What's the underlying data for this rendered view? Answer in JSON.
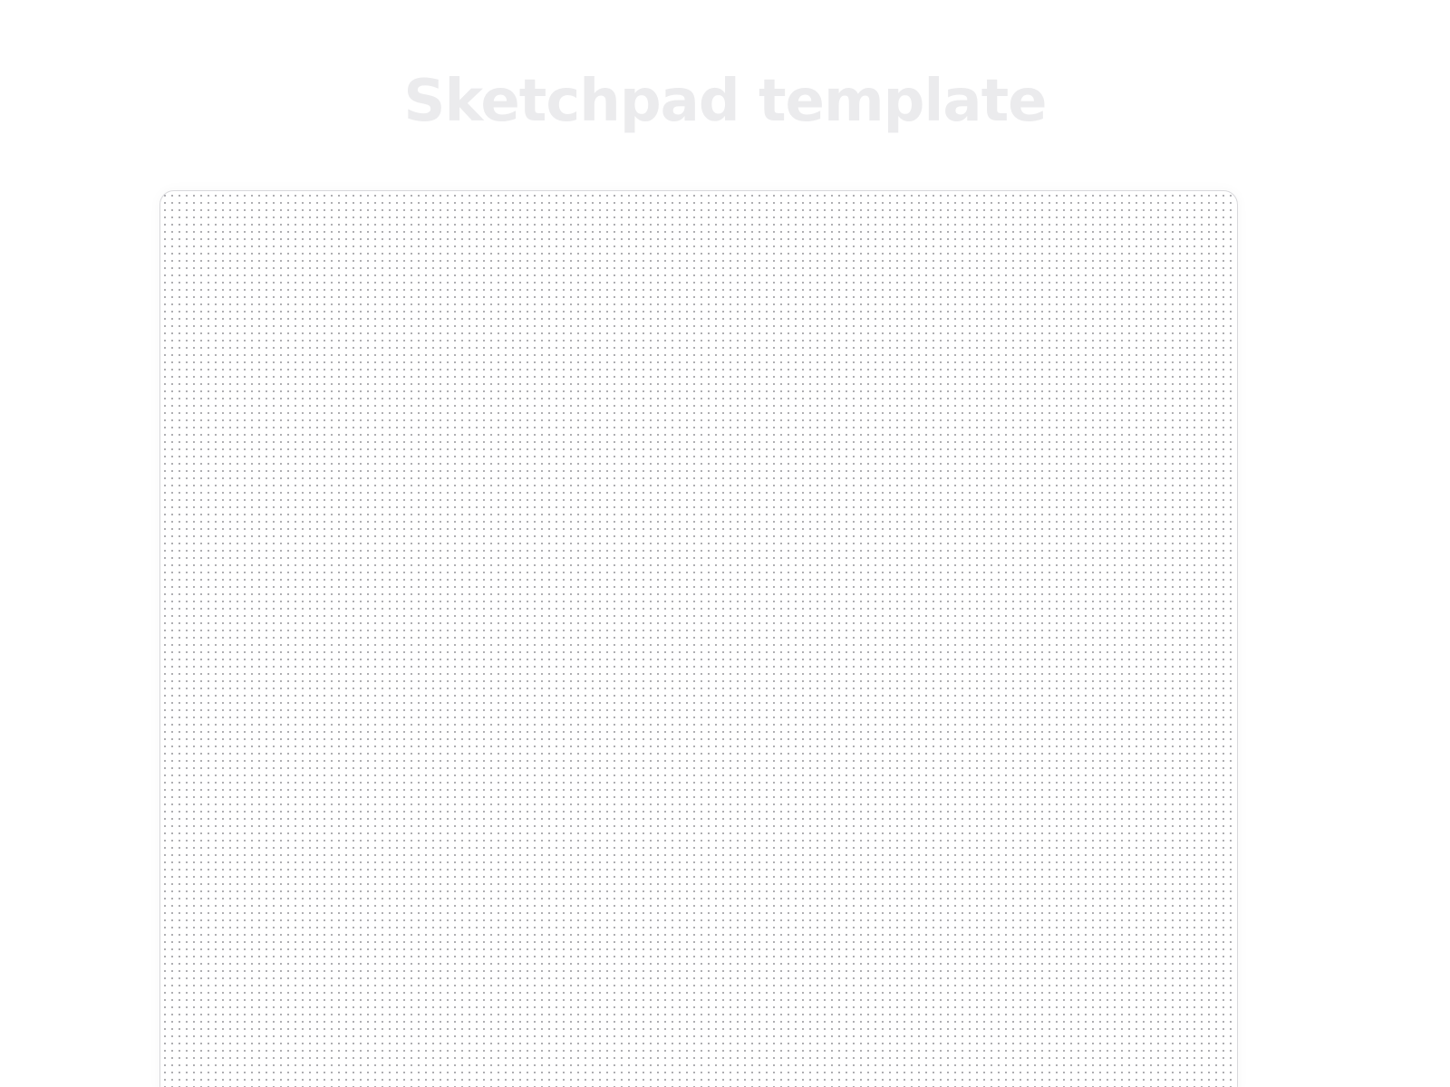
{
  "page": {
    "title": "Sketchpad template"
  },
  "sketchpad": {
    "grid_style": "dot-grid"
  },
  "colors": {
    "title": "#ebebed",
    "canvas_border": "#d9d9dc",
    "grid_dot": "#8e8e93",
    "background": "#ffffff"
  }
}
